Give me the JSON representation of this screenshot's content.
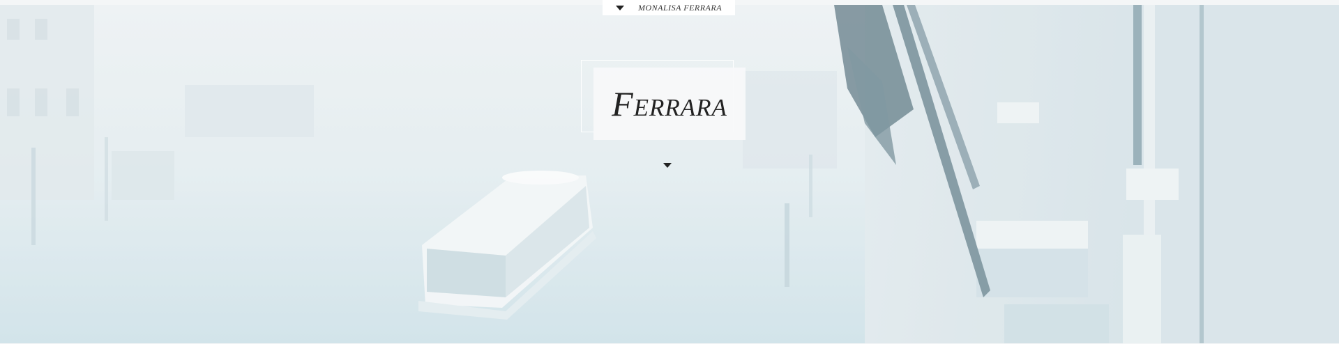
{
  "nav": {
    "tab_label": "MONALISA   FERRARA",
    "caret_icon": "caret-down-icon"
  },
  "hero": {
    "title": "Ferrara",
    "scroll_icon": "caret-down-icon",
    "photo_subject": "foggy canal with water bus and palazzo facade"
  },
  "colors": {
    "tab_background": "#ffffff",
    "title_card_background": "#f7f9fa",
    "text": "#222222",
    "mist_tint": "#d6e6ec"
  }
}
